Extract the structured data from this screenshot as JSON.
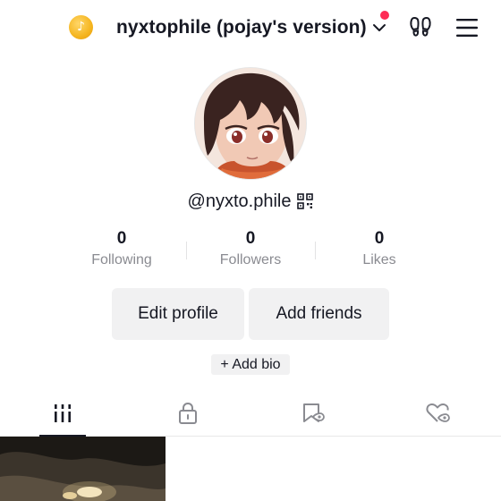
{
  "header": {
    "account_name": "nyxtophile (pojay's version)",
    "coin_icon": "tiktok-coin-icon",
    "notification_color": "#fe2c55",
    "icons": [
      "chevron-down-icon",
      "footprints-icon",
      "hamburger-menu-icon"
    ]
  },
  "profile": {
    "handle": "@nyxto.phile",
    "qr_icon": "qr-code-icon"
  },
  "stats": [
    {
      "value": "0",
      "label": "Following"
    },
    {
      "value": "0",
      "label": "Followers"
    },
    {
      "value": "0",
      "label": "Likes"
    }
  ],
  "actions": {
    "edit_profile": "Edit profile",
    "add_friends": "Add friends",
    "add_bio": "+ Add bio"
  },
  "tabs": [
    {
      "icon": "videos-grid-icon",
      "active": true
    },
    {
      "icon": "private-lock-icon",
      "active": false
    },
    {
      "icon": "favorites-bookmark-icon",
      "active": false
    },
    {
      "icon": "liked-heart-icon",
      "active": false
    }
  ],
  "colors": {
    "text": "#161823",
    "muted": "#8a8b91",
    "button_bg": "#f1f1f2",
    "accent": "#fe2c55"
  }
}
